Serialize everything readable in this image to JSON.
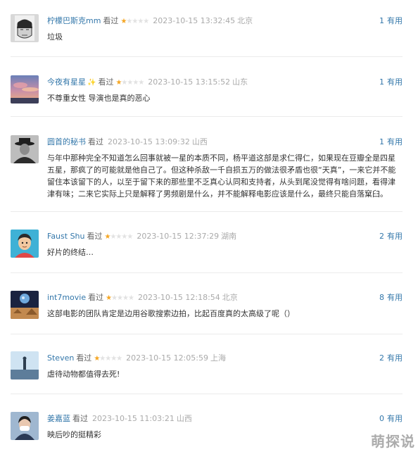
{
  "comments": [
    {
      "user": "柠檬巴斯克mm",
      "status": "看过",
      "stars": 1,
      "time": "2023-10-15 13:32:45",
      "location": "北京",
      "useful_count": "1",
      "useful_label": "有用",
      "text": "垃圾",
      "avatar": "sketch-portrait-avatar"
    },
    {
      "user": "今夜有星星",
      "badge": "✨",
      "status": "看过",
      "stars": 1,
      "time": "2023-10-15 13:15:52",
      "location": "山东",
      "useful_count": "1",
      "useful_label": "有用",
      "text": "不尊重女性 导演也是真的恶心",
      "avatar": "sunset-sky-avatar"
    },
    {
      "user": "圆首的秘书",
      "status": "看过",
      "stars": 0,
      "time": "2023-10-15 13:09:32",
      "location": "山西",
      "useful_count": "1",
      "useful_label": "有用",
      "text": "与年中那种完全不知道怎么回事就被一星的本质不同，杨平道这部是求仁得仁，如果现在豆瓣全是四星五星，那疯了的可能就是他自己了。但这种杀敌一千自损五万的做法很矛盾也很“天真”，一来它并不能留住本该留下的人，以至于留下来的那些里不乏真心认同和支持者，从头到尾没觉得有啥问题，看得津津有味；二来它实际上只是解释了男频剧是什么，并不能解释电影应该是什么，最终只能自落窠臼。",
      "avatar": "hat-man-avatar"
    },
    {
      "user": "Faust Shu",
      "status": "看过",
      "stars": 1,
      "time": "2023-10-15 12:37:29",
      "location": "湖南",
      "useful_count": "2",
      "useful_label": "有用",
      "text": "好片的终结…",
      "avatar": "cartoon-boy-avatar"
    },
    {
      "user": "int7movie",
      "status": "看过",
      "stars": 1,
      "time": "2023-10-15 12:18:54",
      "location": "北京",
      "useful_count": "8",
      "useful_label": "有用",
      "text": "这部电影的团队肯定是边用谷歌搜索边拍，比起百度真的太高级了呢（）",
      "avatar": "planet-scene-avatar"
    },
    {
      "user": "Steven",
      "status": "看过",
      "stars": 1,
      "time": "2023-10-15 12:05:59",
      "location": "上海",
      "useful_count": "2",
      "useful_label": "有用",
      "text": "虐待动物都值得去死!",
      "avatar": "lone-figure-avatar"
    },
    {
      "user": "姜嘉蓝",
      "status": "看过",
      "stars": 0,
      "time": "2023-10-15 11:03:21",
      "location": "山西",
      "useful_count": "0",
      "useful_label": "有用",
      "text": "映后吵的挺精彩",
      "avatar": "masked-girl-avatar"
    }
  ],
  "watermark": "萌探说",
  "colors": {
    "link": "#3377aa",
    "star": "#f5a623",
    "star_off": "#e2e2e2",
    "meta": "#aaaaaa",
    "text": "#333333"
  }
}
